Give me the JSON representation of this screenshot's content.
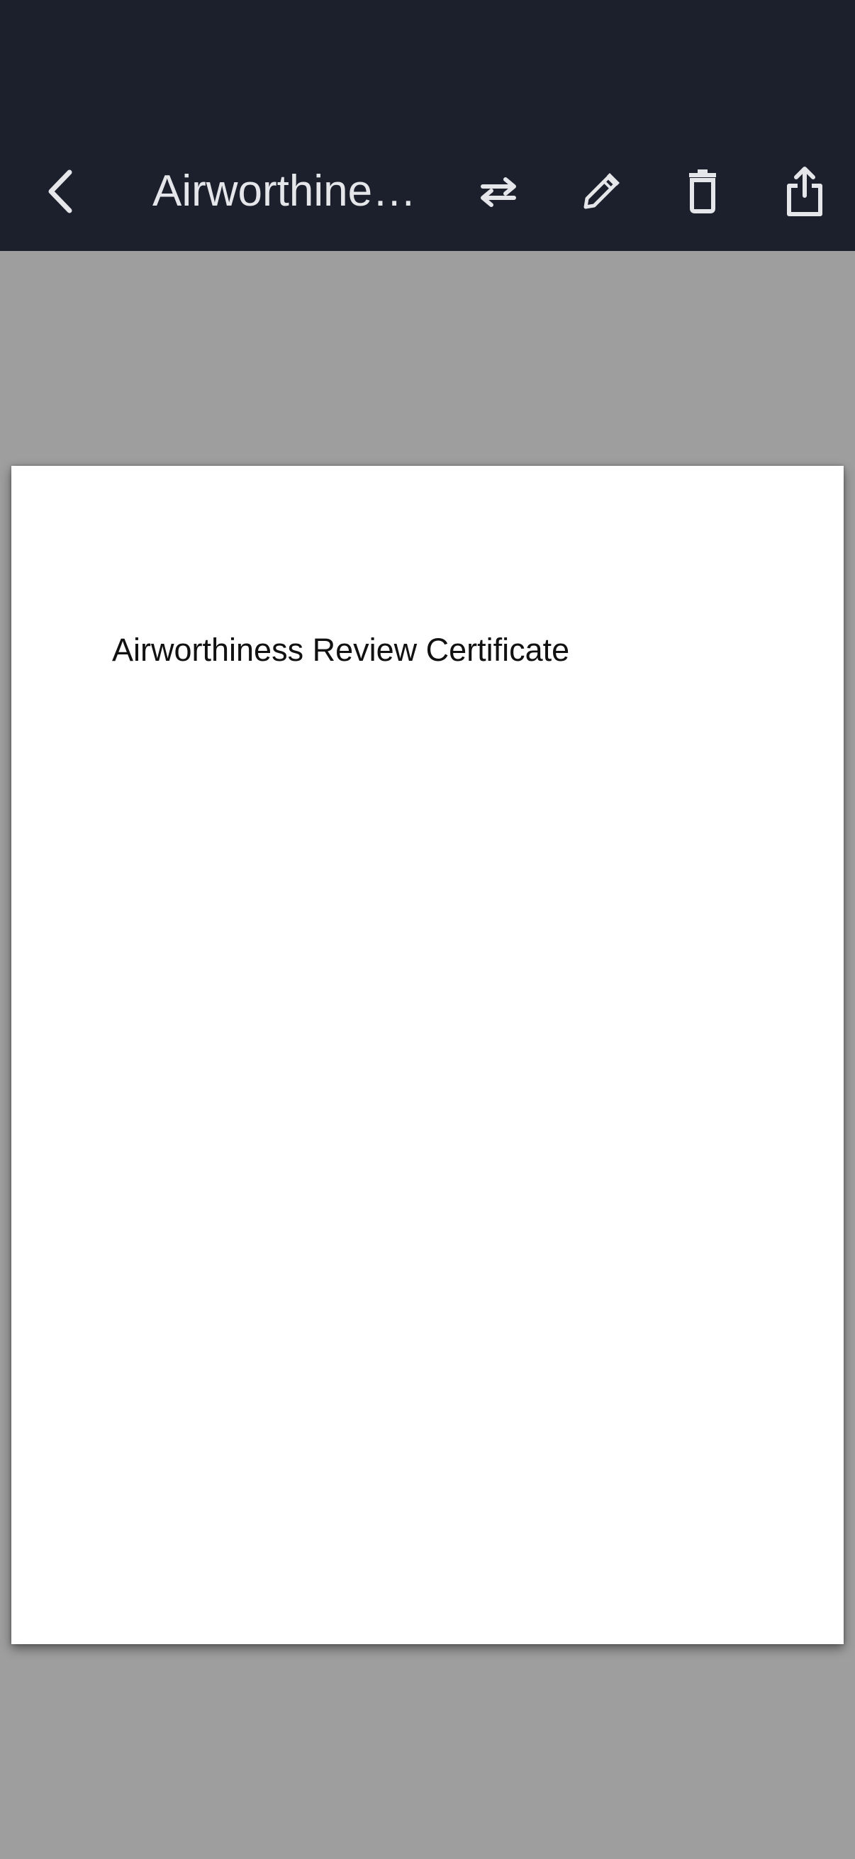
{
  "header": {
    "title": "Airworthiness Review Certificate",
    "background": "#1c202c",
    "icon_color": "#e4e6ea",
    "actions": [
      {
        "icon": "back-chevron-icon"
      },
      {
        "icon": "swap-arrows-icon"
      },
      {
        "icon": "pencil-icon"
      },
      {
        "icon": "trash-icon"
      },
      {
        "icon": "share-icon"
      }
    ]
  },
  "document": {
    "background": "#9e9e9e",
    "page_color": "#ffffff",
    "heading": "Airworthiness Review Certificate"
  }
}
